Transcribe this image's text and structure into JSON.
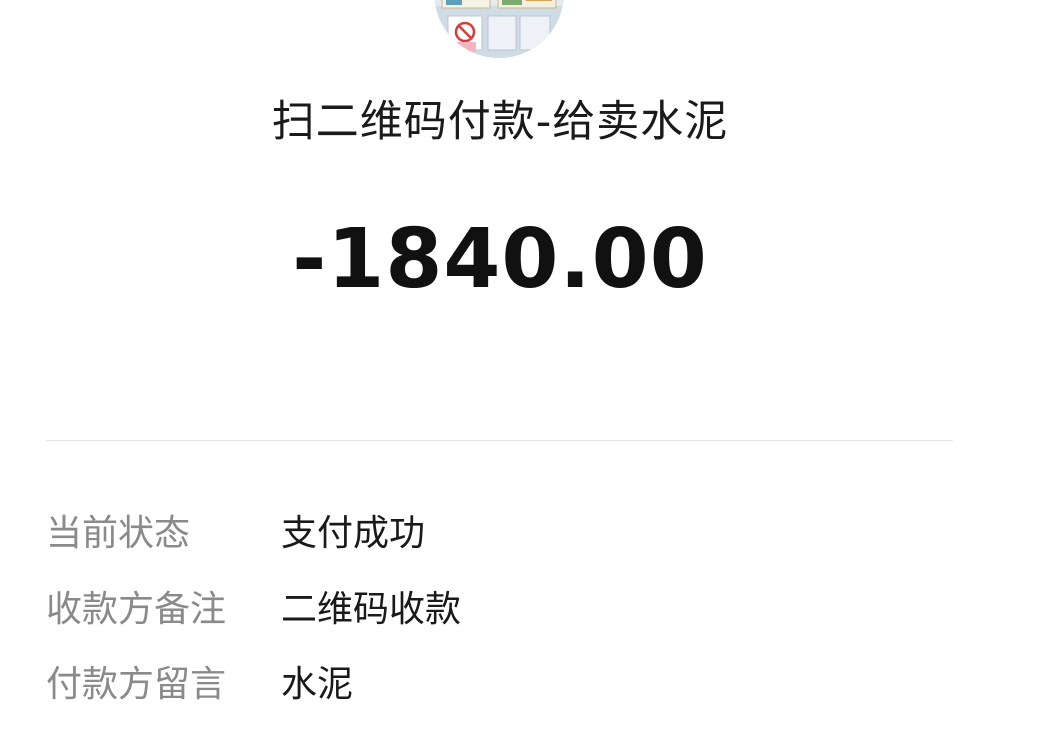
{
  "merchant": {
    "title": "扫二维码付款-给卖水泥",
    "avatar_icon": "merchant-avatar-photo"
  },
  "transaction": {
    "amount": "-1840.00"
  },
  "details": [
    {
      "label": "当前状态",
      "value": "支付成功"
    },
    {
      "label": "收款方备注",
      "value": "二维码收款"
    },
    {
      "label": "付款方留言",
      "value": "水泥"
    }
  ]
}
